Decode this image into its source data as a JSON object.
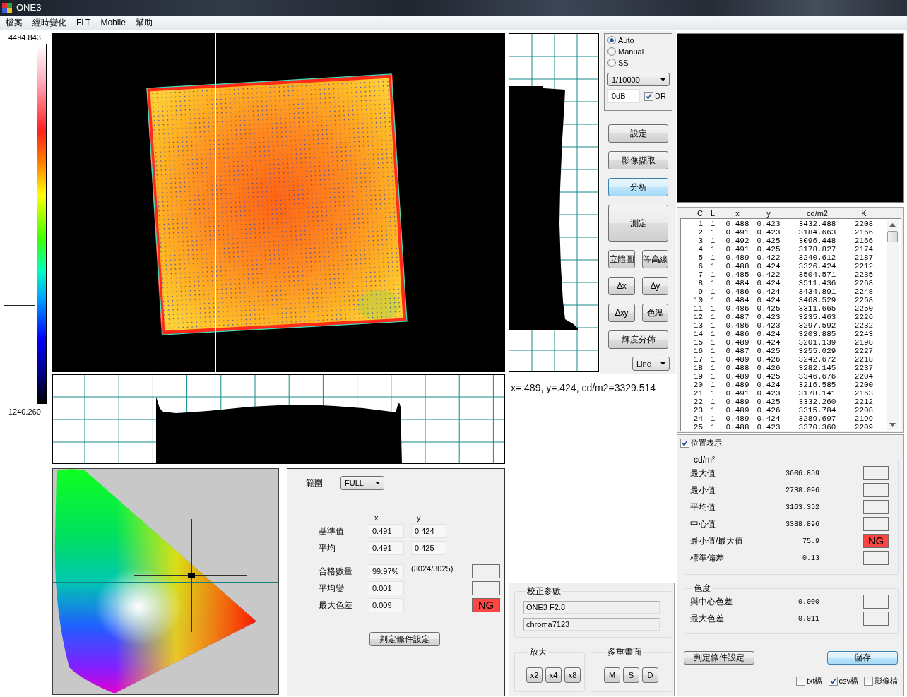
{
  "window": {
    "title": "ONE3"
  },
  "menu": [
    "檔案",
    "經時變化",
    "FLT",
    "Mobile",
    "幫助"
  ],
  "scale": {
    "max": "4494.843",
    "min": "1240.260"
  },
  "readout": "x=.489, y=.424, cd/m2=3329.514",
  "exposure": {
    "modes": [
      {
        "label": "Auto",
        "selected": true
      },
      {
        "label": "Manual",
        "selected": false
      },
      {
        "label": "SS",
        "selected": false
      }
    ],
    "shutter": "1/10000",
    "gain": "0dB",
    "dr": {
      "label": "DR",
      "checked": true
    }
  },
  "actions": [
    [
      {
        "label": "設定",
        "kind": "normal",
        "highlighted": false
      }
    ],
    [
      {
        "label": "影像擷取",
        "kind": "normal",
        "highlighted": false
      }
    ],
    [
      {
        "label": "分析",
        "kind": "normal",
        "highlighted": true
      }
    ],
    [
      {
        "label": "測定",
        "kind": "tall",
        "highlighted": false
      }
    ],
    [
      {
        "label": "立體圖",
        "kind": "normal",
        "highlighted": false
      },
      {
        "label": "等高線",
        "kind": "normal",
        "highlighted": false
      }
    ],
    [
      {
        "label": "Δx",
        "kind": "normal",
        "highlighted": false
      },
      {
        "label": "Δy",
        "kind": "normal",
        "highlighted": false
      }
    ],
    [
      {
        "label": "Δxy",
        "kind": "normal",
        "highlighted": false
      },
      {
        "label": "色溫",
        "kind": "normal",
        "highlighted": false
      }
    ],
    [
      {
        "label": "輝度分佈",
        "kind": "normal",
        "highlighted": false
      }
    ]
  ],
  "view_mode": "Line",
  "table": {
    "columns": [
      "C",
      "L",
      "x",
      "y",
      "cd/m2",
      "K"
    ],
    "rows": [
      [
        "1",
        "1",
        "0.488",
        "0.423",
        "3432.488",
        "2208"
      ],
      [
        "2",
        "1",
        "0.491",
        "0.423",
        "3184.663",
        "2166"
      ],
      [
        "3",
        "1",
        "0.492",
        "0.425",
        "3096.448",
        "2166"
      ],
      [
        "4",
        "1",
        "0.491",
        "0.425",
        "3178.827",
        "2174"
      ],
      [
        "5",
        "1",
        "0.489",
        "0.422",
        "3240.612",
        "2187"
      ],
      [
        "6",
        "1",
        "0.488",
        "0.424",
        "3326.424",
        "2212"
      ],
      [
        "7",
        "1",
        "0.485",
        "0.422",
        "3504.571",
        "2235"
      ],
      [
        "8",
        "1",
        "0.484",
        "0.424",
        "3511.436",
        "2268"
      ],
      [
        "9",
        "1",
        "0.486",
        "0.424",
        "3434.891",
        "2248"
      ],
      [
        "10",
        "1",
        "0.484",
        "0.424",
        "3468.529",
        "2268"
      ],
      [
        "11",
        "1",
        "0.486",
        "0.425",
        "3311.665",
        "2250"
      ],
      [
        "12",
        "1",
        "0.487",
        "0.423",
        "3235.463",
        "2226"
      ],
      [
        "13",
        "1",
        "0.486",
        "0.423",
        "3297.592",
        "2232"
      ],
      [
        "14",
        "1",
        "0.486",
        "0.424",
        "3203.885",
        "2243"
      ],
      [
        "15",
        "1",
        "0.489",
        "0.424",
        "3201.139",
        "2198"
      ],
      [
        "16",
        "1",
        "0.487",
        "0.425",
        "3255.029",
        "2227"
      ],
      [
        "17",
        "1",
        "0.489",
        "0.426",
        "3242.672",
        "2218"
      ],
      [
        "18",
        "1",
        "0.488",
        "0.426",
        "3282.145",
        "2237"
      ],
      [
        "19",
        "1",
        "0.489",
        "0.425",
        "3346.676",
        "2204"
      ],
      [
        "20",
        "1",
        "0.489",
        "0.424",
        "3216.585",
        "2200"
      ],
      [
        "21",
        "1",
        "0.491",
        "0.423",
        "3178.141",
        "2163"
      ],
      [
        "22",
        "1",
        "0.489",
        "0.425",
        "3332.260",
        "2212"
      ],
      [
        "23",
        "1",
        "0.489",
        "0.426",
        "3315.784",
        "2208"
      ],
      [
        "24",
        "1",
        "0.489",
        "0.424",
        "3289.697",
        "2199"
      ],
      [
        "25",
        "1",
        "0.488",
        "0.423",
        "3370.360",
        "2209"
      ]
    ]
  },
  "stats": {
    "position_display": {
      "label": "位置表示",
      "checked": true
    },
    "groups": [
      {
        "title": "cd/m²",
        "rows": [
          {
            "label": "最大值",
            "value": "3606.859",
            "failed": false
          },
          {
            "label": "最小值",
            "value": "2738.096",
            "failed": false
          },
          {
            "label": "平均值",
            "value": "3163.352",
            "failed": false
          },
          {
            "label": "中心值",
            "value": "3388.896",
            "failed": false
          },
          {
            "label": "最小值/最大值",
            "value": "75.9",
            "failed": true,
            "verdict": "NG"
          },
          {
            "label": "標準偏差",
            "value": "0.13",
            "failed": false
          }
        ]
      },
      {
        "title": "色度",
        "rows": [
          {
            "label": "與中心色差",
            "value": "0.000",
            "failed": false
          },
          {
            "label": "最大色差",
            "value": "0.011",
            "failed": false
          }
        ]
      }
    ],
    "buttons": [
      {
        "label": "判定條件設定",
        "highlighted": false
      },
      {
        "label": "儲存",
        "highlighted": true
      }
    ],
    "save_formats": [
      {
        "label": "txt檔",
        "checked": false
      },
      {
        "label": "csv檔",
        "checked": true
      },
      {
        "label": "影像檔",
        "checked": false
      }
    ]
  },
  "judgement": {
    "range_label": "範圍",
    "range": "FULL",
    "columns": [
      "x",
      "y"
    ],
    "rows": [
      {
        "label": "基準值",
        "values": [
          "0.491",
          "0.424"
        ]
      },
      {
        "label": "平均",
        "values": [
          "0.491",
          "0.425"
        ]
      }
    ],
    "checks": [
      {
        "label": "合格數量",
        "value": "99.97%",
        "note": "(3024/3025)",
        "failed": false
      },
      {
        "label": "平均變",
        "value": "0.001",
        "failed": false
      },
      {
        "label": "最大色差",
        "value": "0.009",
        "failed": true,
        "verdict": "NG"
      }
    ],
    "button": "判定條件設定"
  },
  "calibration": {
    "title": "校正参數",
    "fields": [
      "ONE3 F2.8",
      "chroma7123"
    ],
    "groups": [
      {
        "title": "放大",
        "buttons": [
          "x2",
          "x4",
          "x8"
        ]
      },
      {
        "title": "多重畫面",
        "buttons": [
          "M",
          "S",
          "D"
        ]
      }
    ]
  }
}
